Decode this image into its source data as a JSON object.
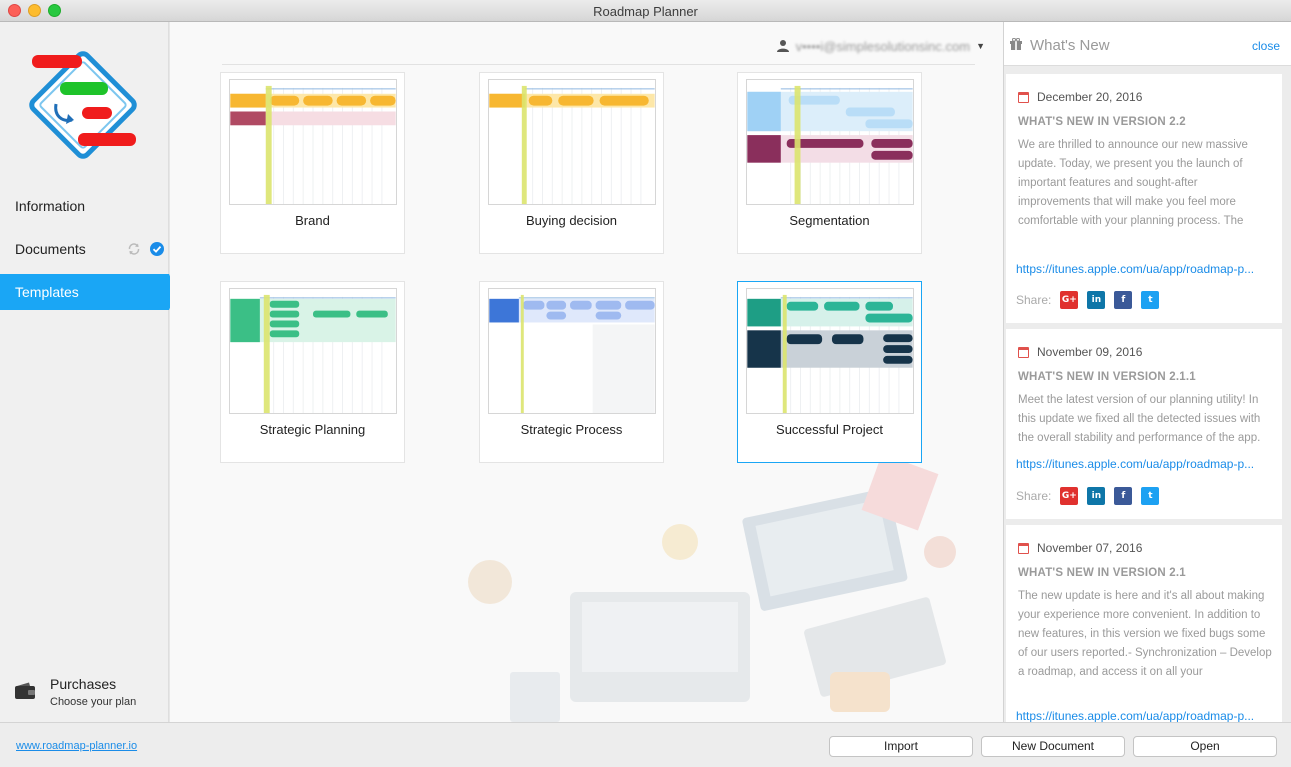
{
  "window": {
    "title": "Roadmap Planner"
  },
  "sidebar": {
    "items": [
      {
        "label": "Information"
      },
      {
        "label": "Documents"
      },
      {
        "label": "Templates"
      }
    ],
    "purchases": {
      "title": "Purchases",
      "subtitle": "Choose your plan"
    }
  },
  "main": {
    "user_email": "v••••i@simplesolutionsinc.com",
    "templates": [
      {
        "label": "Brand"
      },
      {
        "label": "Buying decision"
      },
      {
        "label": "Segmentation"
      },
      {
        "label": "Strategic Planning"
      },
      {
        "label": "Strategic Process"
      },
      {
        "label": "Successful Project"
      }
    ],
    "selected_template": "Successful Project"
  },
  "whats_new": {
    "title": "What's New",
    "close_label": "close",
    "share_label": "Share:",
    "items": [
      {
        "date": "December 20, 2016",
        "headline": "WHAT'S NEW IN VERSION 2.2",
        "body": "We are thrilled to announce our new massive update. Today, we present you the launch of important features and sought-after improvements that will make you feel more comfortable with your planning process. The",
        "link": "https://itunes.apple.com/ua/app/roadmap-p..."
      },
      {
        "date": "November 09, 2016",
        "headline": "WHAT'S NEW IN VERSION 2.1.1",
        "body": "Meet the latest version of our planning utility! In this update we fixed all the detected issues with the overall stability and performance of the app.",
        "link": "https://itunes.apple.com/ua/app/roadmap-p..."
      },
      {
        "date": "November 07, 2016",
        "headline": "WHAT'S NEW IN VERSION 2.1",
        "body": "The new update is here and it's all about making your experience more convenient. In addition to new features, in this version we fixed bugs some of our users reported.- Synchronization – Develop a roadmap, and access it on all your",
        "link": "https://itunes.apple.com/ua/app/roadmap-p..."
      }
    ]
  },
  "footer": {
    "site_link": "www.roadmap-planner.io",
    "import_label": "Import",
    "new_document_label": "New Document",
    "open_label": "Open"
  },
  "colors": {
    "accent": "#1aa6f5",
    "link": "#1a8ce8",
    "timeline_marker": "#d9e36b"
  }
}
